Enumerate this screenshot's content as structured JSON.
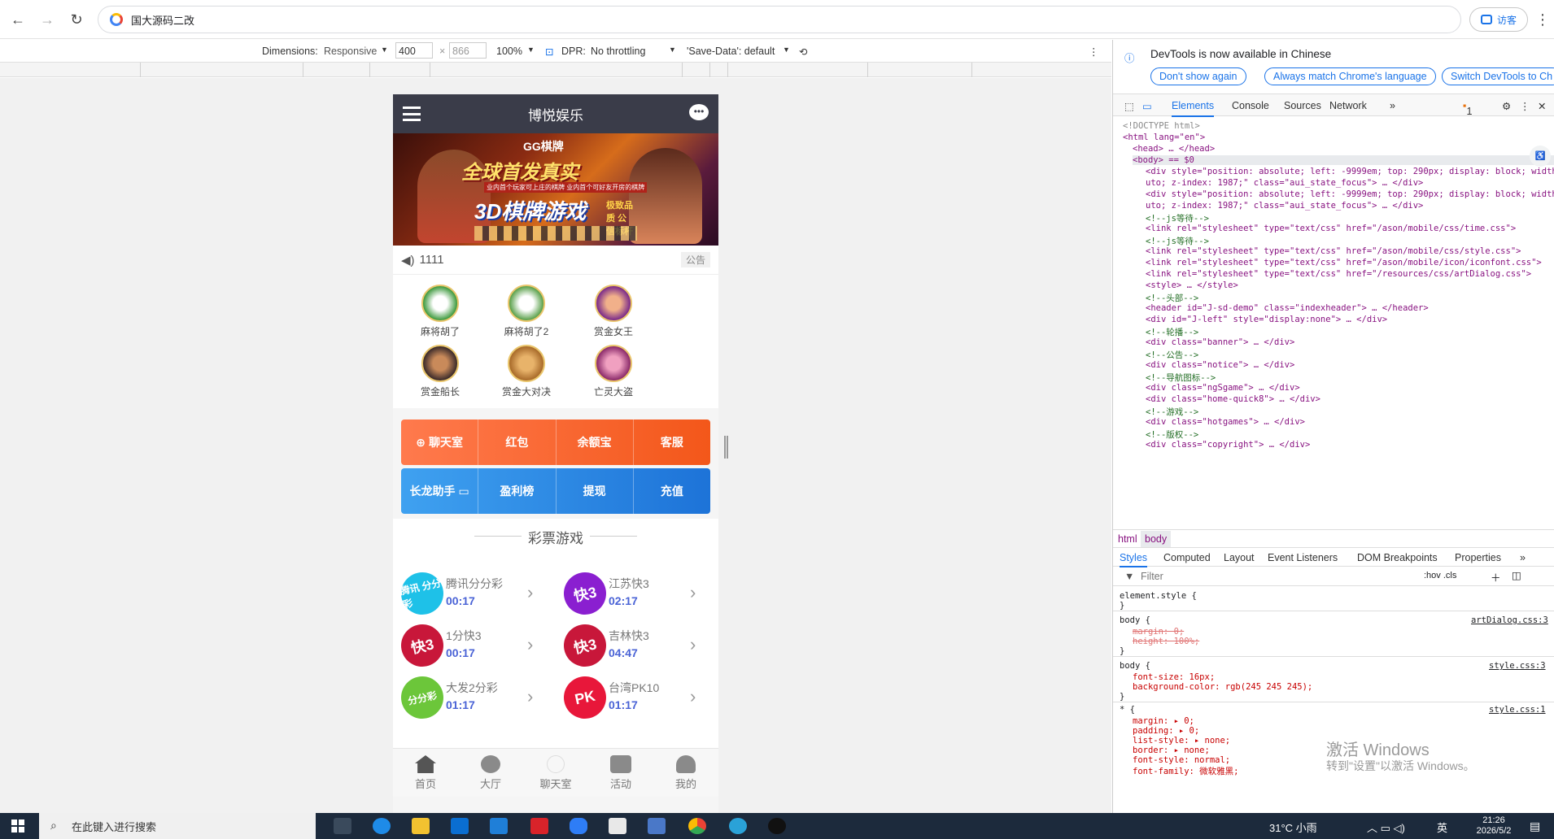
{
  "browser": {
    "url": "国大源码二改",
    "visitor": "访客"
  },
  "device_bar": {
    "dimensions_label": "Dimensions:",
    "mode": "Responsive",
    "width": "400",
    "height": "866",
    "zoom": "100%",
    "dpr": "DPR:",
    "throttle": "No throttling",
    "save_data": "'Save-Data': default"
  },
  "app": {
    "title": "博悦娱乐",
    "banner": {
      "brand": "GG棋牌",
      "headline": "全球首发真实",
      "sub": "业内首个玩家可上庄的棋牌 业内首个可好友开房的棋牌",
      "headline2": "3D棋牌游戏",
      "tag": "极致品质 公信标杆"
    },
    "notice": {
      "text": "1111",
      "label": "公告"
    },
    "games": [
      "麻将胡了",
      "麻将胡了2",
      "赏金女王",
      "赏金船长",
      "赏金大对决",
      "亡灵大盗"
    ],
    "quick1": [
      "聊天室",
      "红包",
      "余额宝",
      "客服"
    ],
    "quick2": [
      "长龙助手",
      "盈利榜",
      "提现",
      "充值"
    ],
    "lottery_title": "彩票游戏",
    "lotteries": [
      {
        "name": "腾讯分分彩",
        "time": "00:17",
        "icon": "腾讯 分分彩"
      },
      {
        "name": "江苏快3",
        "time": "02:17",
        "icon": "快3"
      },
      {
        "name": "1分快3",
        "time": "00:17",
        "icon": "快3"
      },
      {
        "name": "吉林快3",
        "time": "04:47",
        "icon": "快3"
      },
      {
        "name": "大发2分彩",
        "time": "01:17",
        "icon": "分分彩"
      },
      {
        "name": "台湾PK10",
        "time": "01:17",
        "icon": "PK"
      }
    ],
    "nav": [
      "首页",
      "大厅",
      "聊天室",
      "活动",
      "我的"
    ]
  },
  "devtools": {
    "info": "DevTools is now available in Chinese",
    "chips": [
      "Don't show again",
      "Always match Chrome's language",
      "Switch DevTools to Ch"
    ],
    "tabs": [
      "Elements",
      "Console",
      "Sources",
      "Network"
    ],
    "issues": "1",
    "dom": [
      "<!DOCTYPE html>",
      "<html lang=\"en\">",
      "<head> … </head>",
      "<body> == $0",
      "<div style=\"position: absolute; left: -9999em; top: 290px; display: block; width: a",
      "uto; z-index: 1987;\" class=\"aui_state_focus\"> … </div>",
      "<div style=\"position: absolute; left: -9999em; top: 290px; display: block; width: a",
      "uto; z-index: 1987;\" class=\"aui_state_focus\"> … </div>",
      "<!--js等待-->",
      "<link rel=\"stylesheet\" type=\"text/css\" href=\"/ason/mobile/css/time.css\">",
      "<!--js等待-->",
      "<link rel=\"stylesheet\" type=\"text/css\" href=\"/ason/mobile/css/style.css\">",
      "<link rel=\"stylesheet\" type=\"text/css\" href=\"/ason/mobile/icon/iconfont.css\">",
      "<link rel=\"stylesheet\" type=\"text/css\" href=\"/resources/css/artDialog.css\">",
      "<style> … </style>",
      "<!--头部-->",
      "<header id=\"J-sd-demo\" class=\"indexheader\"> … </header>",
      "<div id=\"J-left\" style=\"display:none\"> … </div>",
      "<!--轮播-->",
      "<div class=\"banner\"> … </div>",
      "<!--公告-->",
      "<div class=\"notice\"> … </div>",
      "<!--导航图标-->",
      "<div class=\"ngSgame\"> … </div>",
      "<div class=\"home-quick8\"> … </div>",
      "<!--游戏-->",
      "<div class=\"hotgames\"> … </div>",
      "<!--版权-->",
      "<div class=\"copyright\"> … </div>"
    ],
    "crumbs": [
      "html",
      "body"
    ],
    "style_tabs": [
      "Styles",
      "Computed",
      "Layout",
      "Event Listeners",
      "DOM Breakpoints",
      "Properties"
    ],
    "filter": "Filter",
    "filter_tools": ":hov .cls",
    "styles": [
      "element.style {",
      "}",
      "body {",
      "margin: 0;",
      "height: 100%;",
      "}",
      "body {",
      "font-size: 16px;",
      "background-color: rgb(245 245 245);",
      "}",
      "* {",
      "margin: ▸ 0;",
      "padding: ▸ 0;",
      "list-style: ▸ none;",
      "border: ▸ none;",
      "font-style: normal;",
      "font-family: 微软雅黑;"
    ],
    "style_sources": [
      "artDialog.css:3",
      "style.css:3",
      "style.css:1"
    ]
  },
  "watermark": {
    "line1": "激活 Windows",
    "line2": "转到\"设置\"以激活 Windows。"
  },
  "taskbar": {
    "search": "在此键入进行搜索",
    "weather": "31°C 小雨",
    "time": "21:26",
    "date": "2026/5/2",
    "lang": "英"
  }
}
